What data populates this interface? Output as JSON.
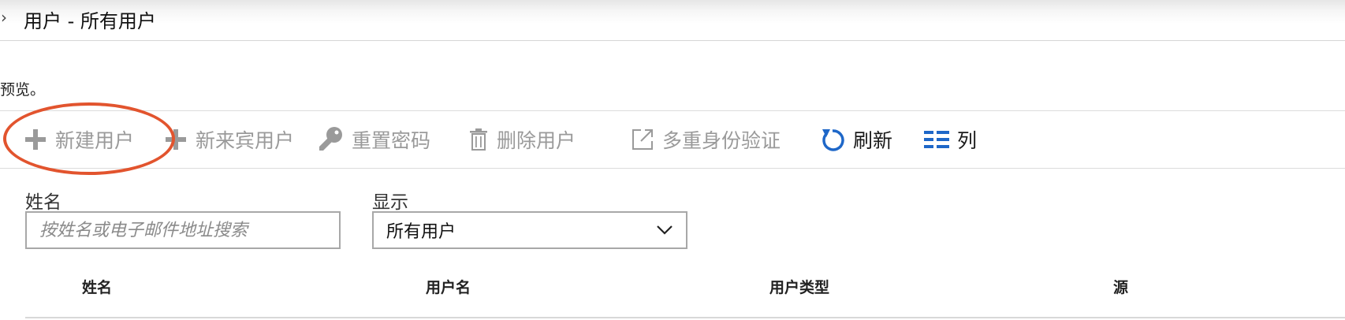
{
  "header": {
    "chevron": "›",
    "title": "用户 - 所有用户"
  },
  "notice": "预览。",
  "toolbar": {
    "new_user": "新建用户",
    "new_guest_user": "新来宾用户",
    "reset_password": "重置密码",
    "delete_user": "删除用户",
    "mfa": "多重身份验证",
    "refresh": "刷新",
    "columns": "列"
  },
  "filters": {
    "name_label": "姓名",
    "search_placeholder": "按姓名或电子邮件地址搜索",
    "show_label": "显示",
    "show_value": "所有用户"
  },
  "table": {
    "columns": [
      "姓名",
      "用户名",
      "用户类型",
      "源"
    ]
  },
  "colors": {
    "accent": "#1e67c8",
    "highlight_circle": "#e2542e",
    "disabled": "#9a9a9a"
  }
}
